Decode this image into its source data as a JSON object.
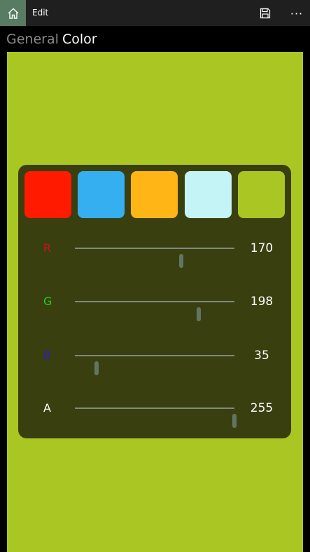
{
  "titlebar": {
    "title": "Edit",
    "home_icon": "home-icon",
    "save_icon": "save-icon",
    "more_label": "···"
  },
  "tabs": [
    {
      "label": "General"
    },
    {
      "label": "Color"
    }
  ],
  "preview_color": "#aac623",
  "panel_color": "#3a3f0f",
  "swatches": [
    {
      "color": "#ff1a00"
    },
    {
      "color": "#35aff0"
    },
    {
      "color": "#ffb516"
    },
    {
      "color": "#c5f4f7"
    },
    {
      "color": "#aac623"
    }
  ],
  "channels": [
    {
      "label": "R",
      "value": "170",
      "fraction": 0.667,
      "label_color": "#d0101a"
    },
    {
      "label": "G",
      "value": "198",
      "fraction": 0.776,
      "label_color": "#1fd01f"
    },
    {
      "label": "B",
      "value": "35",
      "fraction": 0.137,
      "label_color": "#2a1fc0"
    },
    {
      "label": "A",
      "value": "255",
      "fraction": 1.0,
      "label_color": "#ffffff"
    }
  ]
}
